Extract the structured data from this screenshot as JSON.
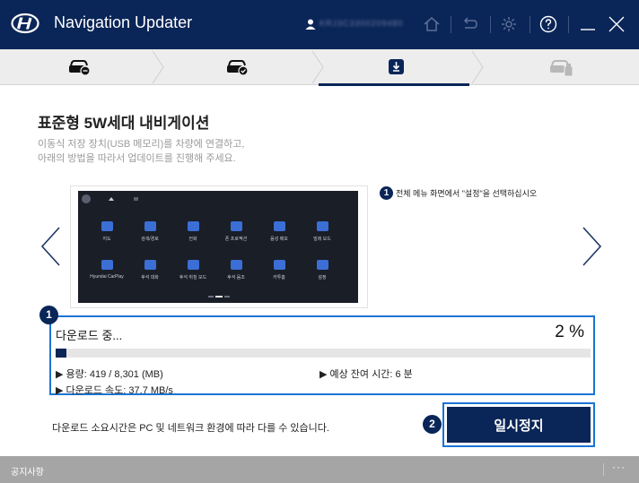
{
  "app": {
    "title": "Navigation Updater",
    "user_id": "KRJ3C3300209480"
  },
  "titlebar": {
    "icons": [
      "home-icon",
      "back-icon",
      "settings-icon",
      "help-icon",
      "minimize-icon",
      "close-icon"
    ]
  },
  "steps": {
    "items": [
      {
        "icon": "car-add-icon",
        "state": "done"
      },
      {
        "icon": "car-check-icon",
        "state": "done"
      },
      {
        "icon": "download-icon",
        "state": "active"
      },
      {
        "icon": "car-usb-icon",
        "state": "pending"
      }
    ]
  },
  "main": {
    "title": "표준형 5W세대 내비게이션",
    "description": "이동식 저장 장치(USB 메모리)를 차량에 연결하고,\n아래의 방법을 따라서 업데이트를 진행해 주세요."
  },
  "guide": {
    "step_number": "1",
    "instruction": "전체 메뉴 화면에서 \"설정\"을 선택하십시오",
    "screen_apps": [
      "지도",
      "검색/경로",
      "전화",
      "폰 프로젝션",
      "음성 메모",
      "빌레 모드",
      "Hyundai CarPlay",
      "후석 대화",
      "후석 취침 모드",
      "후석 음조",
      "카투홈",
      "설정"
    ]
  },
  "download": {
    "badge": "1",
    "label": "다운로드 중...",
    "percent_text": "2 %",
    "progress": 0.02,
    "capacity": "▶ 용량: 419 / 8,301 (MB)",
    "remaining": "▶ 예상 잔여 시간: 6 분",
    "speed": "▶ 다운로드 속도: 37.7 MB/s"
  },
  "bottom": {
    "note": "다운로드 소요시간은 PC 및 네트워크 환경에 따라 다를 수 있습니다.",
    "badge": "2",
    "pause_label": "일시정지"
  },
  "footer": {
    "label": "공지사항",
    "more": "···"
  },
  "colors": {
    "navy": "#0a2557",
    "highlight_blue": "#1a74d4",
    "footer_gray": "#a5a5a5"
  }
}
